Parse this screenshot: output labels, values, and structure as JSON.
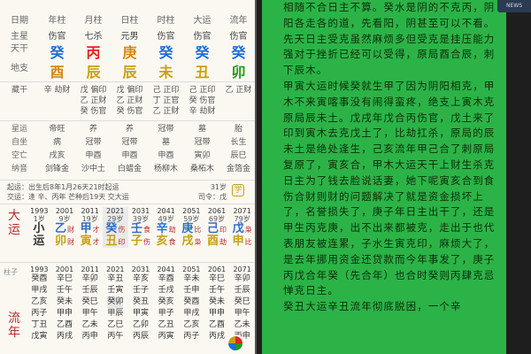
{
  "chart": {
    "header_labels": [
      "日期",
      "年柱",
      "月柱",
      "日柱",
      "时柱",
      "大运",
      "流年"
    ],
    "shishen_label": "主星",
    "shishen": [
      "伤官",
      "七杀",
      "元男",
      "伤官",
      "伤官",
      "伤官"
    ],
    "gan_label": "天干",
    "gan": [
      "癸",
      "丙",
      "庚",
      "癸",
      "癸",
      "癸"
    ],
    "zhi_label": "地支",
    "zhi": [
      "酉",
      "辰",
      "辰",
      "未",
      "丑",
      "卯"
    ],
    "canggan_label": "藏干",
    "canggan": [
      [
        "辛 劫财"
      ],
      [
        "戊 偏印",
        "乙 正财",
        "癸 伤官"
      ],
      [
        "戊 偏印",
        "乙 正财",
        "癸 伤官"
      ],
      [
        "己 正印",
        "丁 正官",
        "乙 正财"
      ],
      [
        "己 正印",
        "癸 伤官",
        "辛 劫财"
      ],
      [
        "乙 正财"
      ]
    ],
    "xingyun_label": "星运",
    "xingyun": [
      "帝旺",
      "养",
      "养",
      "冠带",
      "墓",
      "胎"
    ],
    "zizuo_label": "自坐",
    "zizuo": [
      "病",
      "冠带",
      "冠带",
      "墓",
      "冠带",
      "长生"
    ],
    "kongwang_label": "空亡",
    "kongwang": [
      "戌亥",
      "申酉",
      "申酉",
      "申酉",
      "寅卯",
      "辰巳"
    ],
    "nayin_label": "纳音",
    "nayin": [
      "剑锋金",
      "沙中土",
      "白蜡金",
      "杨柳木",
      "桑柘木",
      "金箔金"
    ],
    "info_line1": "起运：出生后8年1月26天21时起运",
    "info_line2": "交运：逢 辛、丙年 芒种后19天 交大运",
    "info_right1": "31岁",
    "info_right2": "司令：戊",
    "square_icon_text": "学",
    "dayun_side": [
      "大",
      "运"
    ],
    "dayun": [
      {
        "year": "1993",
        "age": "1岁",
        "top": "小",
        "bottom": "运",
        "r1": "",
        "r2": ""
      },
      {
        "year": "2001",
        "age": "9岁",
        "top": "乙",
        "bottom": "卯",
        "r1": "财",
        "r2": "财"
      },
      {
        "year": "2011",
        "age": "19岁",
        "top": "甲",
        "bottom": "寅",
        "r1": "才",
        "r2": "才"
      },
      {
        "year": "2021",
        "age": "29岁",
        "top": "癸",
        "bottom": "丑",
        "r1": "伤",
        "r2": "印"
      },
      {
        "year": "2031",
        "age": "39岁",
        "top": "壬",
        "bottom": "子",
        "r1": "食",
        "r2": "伤"
      },
      {
        "year": "2041",
        "age": "49岁",
        "top": "辛",
        "bottom": "亥",
        "r1": "劫",
        "r2": "食"
      },
      {
        "year": "2051",
        "age": "59岁",
        "top": "庚",
        "bottom": "戌",
        "r1": "比",
        "r2": "枭"
      },
      {
        "year": "2061",
        "age": "69岁",
        "top": "己",
        "bottom": "酉",
        "r1": "印",
        "r2": "劫"
      },
      {
        "year": "2071",
        "age": "79岁",
        "top": "戊",
        "bottom": "申",
        "r1": "枭",
        "r2": "比"
      }
    ],
    "liunian_side": [
      "流",
      "年"
    ],
    "liunian_label": "柱子",
    "liunian": [
      {
        "year": "1993",
        "rows": [
          "癸酉",
          "甲戌",
          "乙亥",
          "丙子",
          "丁丑",
          "戊寅"
        ]
      },
      {
        "year": "2001",
        "rows": [
          "辛巳",
          "壬午",
          "癸未",
          "甲申",
          "乙酉",
          "丙戌"
        ]
      },
      {
        "year": "2011",
        "rows": [
          "辛卯",
          "壬辰",
          "癸巳",
          "甲午",
          "乙未",
          "丙申"
        ]
      },
      {
        "year": "2021",
        "rows": [
          "辛丑",
          "壬寅",
          "癸卯",
          "甲辰",
          "乙巳",
          "丙午"
        ]
      },
      {
        "year": "2031",
        "rows": [
          "辛亥",
          "壬子",
          "癸丑",
          "甲寅",
          "乙卯",
          "丙辰"
        ]
      },
      {
        "year": "2041",
        "rows": [
          "辛酉",
          "壬戌",
          "癸亥",
          "甲子",
          "乙丑",
          "丙寅"
        ]
      },
      {
        "year": "2051",
        "rows": [
          "辛未",
          "壬申",
          "癸酉",
          "甲戌",
          "乙亥",
          "丙子"
        ]
      },
      {
        "year": "2061",
        "rows": [
          "辛巳",
          "壬午",
          "癸未",
          "甲申",
          "乙酉",
          "丙戌"
        ]
      },
      {
        "year": "2071",
        "rows": [
          "辛卯",
          "壬辰",
          "癸巳",
          "甲午",
          "乙未",
          "丙申"
        ]
      }
    ]
  },
  "article": {
    "paragraphs": [
      "相随不合日主不算。癸水是阴的不克丙，阴阳各走各的道，先看阳，阴甚至可以不看。先天日主受克虽然麻烦多但受克是挂压能力强对于挫折已经可以受得，原局酉合辰，刺下辰木。",
      "甲寅大运时候癸就生甲了因为阴阳相克，甲木不来寅喀事没有闹得蛮疼，绝支上寅木克原局辰未土。戊戌年戊合丙伤官，戊土来了印到寅木去克戊土了，比劫扛杀，原局的辰未土是绝处逢生，己亥流年甲己合了刺原局复原了，寅亥合，甲木大运天干上财生杀克日主为了钱去脸说话妻，她下呢寅亥合到食伤合财则财的问题解决了就是资金损坏上了，名誉损失了，庚子年日主出干了，还是甲生丙克庚，出不出来都被克，走出于也代表朋友被连累，子水生寅克印，麻烦大了，是去年挪用资金还贷款而今年事发了，庚子丙戊合年癸（先合年）也合时癸则丙肆克忌惮克日主。",
      "癸丑大运辛丑流年彻底脱困，一个辛"
    ]
  },
  "watermark": "NEWS"
}
